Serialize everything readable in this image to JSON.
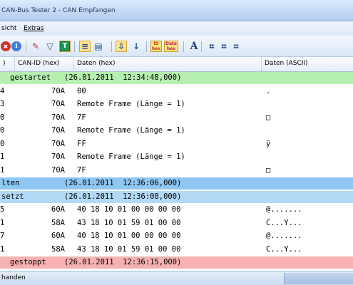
{
  "window": {
    "title": "CAN-Bus Tester 2 - CAN Empfangen"
  },
  "menu": {
    "items": [
      "sicht",
      "Extras"
    ]
  },
  "toolbar": {
    "buttons": [
      {
        "name": "stop-icon",
        "glyph": "✖",
        "color": "#d9302a"
      },
      {
        "name": "info-icon",
        "glyph": "i",
        "color": "#2f6fd0"
      },
      {
        "name": "pencil-icon",
        "glyph": "✎",
        "color": "#c0392b"
      },
      {
        "name": "filter-icon",
        "glyph": "▽",
        "color": "#1f4f8a"
      },
      {
        "name": "trigger-icon",
        "glyph": "T",
        "color": "#ffffff"
      },
      {
        "name": "list-view-icon",
        "glyph": "≡",
        "color": "#1f4f8a"
      },
      {
        "name": "table-view-icon",
        "glyph": "▤",
        "color": "#1f4f8a"
      },
      {
        "name": "autoscroll-icon",
        "glyph": "⇩",
        "color": "#1f4f8a"
      },
      {
        "name": "download-icon",
        "glyph": "↓",
        "color": "#1f4f8a"
      },
      {
        "name": "id-hex-icon",
        "top": "ID",
        "bottom": "hex",
        "color": "#c83b13"
      },
      {
        "name": "data-hex-icon",
        "top": "Data",
        "bottom": "hex",
        "color": "#c8136a"
      },
      {
        "name": "font-icon",
        "glyph": "A",
        "color": "#1f3f7a"
      },
      {
        "name": "find-icon",
        "glyph": "⌗",
        "color": "#1f3f7a"
      },
      {
        "name": "find-next-icon",
        "glyph": "⌗",
        "color": "#1f3f7a"
      },
      {
        "name": "find-previous-icon",
        "glyph": "⌗",
        "color": "#1f3f7a"
      }
    ]
  },
  "columns": [
    {
      "label": ")"
    },
    {
      "label": "CAN-ID (hex)"
    },
    {
      "label": "Daten (hex)"
    },
    {
      "label": "Daten (ASCII)"
    }
  ],
  "rows": [
    {
      "type": "event",
      "bg": "#b6f0b0",
      "text": "gestartet",
      "stamp": "(26.01.2011  12:34:48,000)"
    },
    {
      "type": "data",
      "c0": "4",
      "id": "70A",
      "hex": "00",
      "ascii": "."
    },
    {
      "type": "data",
      "c0": "3",
      "id": "70A",
      "hex": "Remote Frame (Länge = 1)",
      "ascii": ""
    },
    {
      "type": "data",
      "c0": "0",
      "id": "70A",
      "hex": "7F",
      "ascii": "□"
    },
    {
      "type": "data",
      "c0": "0",
      "id": "70A",
      "hex": "Remote Frame (Länge = 1)",
      "ascii": ""
    },
    {
      "type": "data",
      "c0": "0",
      "id": "70A",
      "hex": "FF",
      "ascii": "ÿ"
    },
    {
      "type": "data",
      "c0": "1",
      "id": "70A",
      "hex": "Remote Frame (Länge = 1)",
      "ascii": ""
    },
    {
      "type": "data",
      "c0": "1",
      "id": "70A",
      "hex": "7F",
      "ascii": "□"
    },
    {
      "type": "event",
      "bg": "#8fc6f2",
      "text": "lten",
      "stamp": "(26.01.2011  12:36:06,000)"
    },
    {
      "type": "event",
      "bg": "#b2daf6",
      "text": "setzt",
      "stamp": "(26.01.2011  12:36:08,000)"
    },
    {
      "type": "data",
      "c0": "5",
      "id": "60A",
      "hex": "40 18 10 01 00 00 00 00",
      "ascii": "@......."
    },
    {
      "type": "data",
      "c0": "1",
      "id": "58A",
      "hex": "43 18 10 01 59 01 00 00",
      "ascii": "C...Y..."
    },
    {
      "type": "data",
      "c0": "7",
      "id": "60A",
      "hex": "40 18 10 01 00 00 00 00",
      "ascii": "@......."
    },
    {
      "type": "data",
      "c0": "1",
      "id": "58A",
      "hex": "43 18 10 01 59 01 00 00",
      "ascii": "C...Y..."
    },
    {
      "type": "event",
      "bg": "#f7b1b1",
      "text": "gestoppt",
      "stamp": "(26.01.2011  12:36:15,000)"
    }
  ],
  "status": {
    "text": "handen"
  }
}
